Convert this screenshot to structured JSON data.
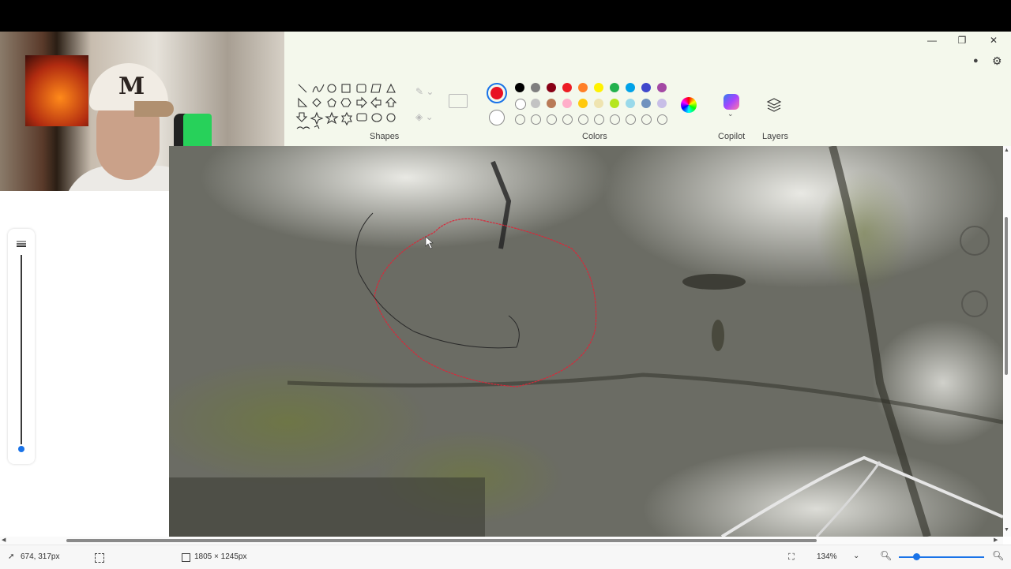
{
  "window": {
    "minimize": "—",
    "maximize": "❐",
    "close": "✕",
    "account_icon": "person-icon",
    "settings_icon": "gear-icon"
  },
  "ribbon": {
    "groups": {
      "shapes": "Shapes",
      "colors": "Colors",
      "copilot": "Copilot",
      "layers": "Layers"
    },
    "shape_tools": [
      "line",
      "curve",
      "oval",
      "rectangle",
      "rounded-rectangle",
      "polygon",
      "triangle",
      "right-triangle",
      "diamond",
      "pentagon",
      "hexagon",
      "arrow-right",
      "arrow-left",
      "arrow-up",
      "arrow-down",
      "four-point-star",
      "five-point-star",
      "six-point-star",
      "callout-rounded-rect",
      "callout-oval",
      "callout-cloud",
      "heart",
      "lightning"
    ],
    "primary_color": "#e81123",
    "secondary_color": "#ffffff",
    "palette_row1": [
      "#000000",
      "#7f7f7f",
      "#880015",
      "#ed1c24",
      "#ff7f27",
      "#fff200",
      "#22b14c",
      "#00a2e8",
      "#3f48cc",
      "#a349a4"
    ],
    "palette_row2": [
      "#ffffff",
      "#c3c3c3",
      "#b97a57",
      "#ffaec9",
      "#ffc90e",
      "#efe4b0",
      "#b5e61d",
      "#99d9ea",
      "#7092be",
      "#c8bfe7"
    ],
    "palette_row3_empty_count": 10
  },
  "canvas": {
    "annotation_red": "#d9283a",
    "annotation_dark": "#2a2a2a"
  },
  "status": {
    "cursor_position": "674, 317px",
    "canvas_size": "1805 × 1245px",
    "zoom": "134%"
  }
}
